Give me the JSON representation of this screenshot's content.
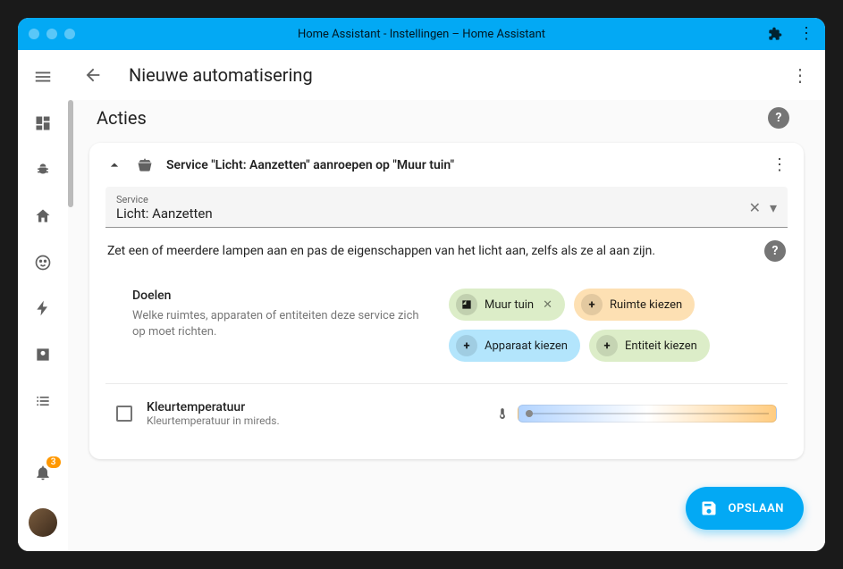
{
  "window_title": "Home Assistant - Instellingen – Home Assistant",
  "appbar": {
    "title": "Nieuwe automatisering"
  },
  "section": {
    "title": "Acties"
  },
  "action": {
    "header": "Service \"Licht: Aanzetten\" aanroepen op \"Muur tuin\"",
    "service_label": "Service",
    "service_value": "Licht: Aanzetten",
    "description": "Zet een of meerdere lampen aan en pas de eigenschappen van het licht aan, zelfs als ze al aan zijn."
  },
  "targets": {
    "title": "Doelen",
    "subtitle": "Welke ruimtes, apparaten of entiteiten deze service zich op moet richten.",
    "selected_area": "Muur tuin",
    "add_area": "Ruimte kiezen",
    "add_device": "Apparaat kiezen",
    "add_entity": "Entiteit kiezen"
  },
  "prop": {
    "title": "Kleurtemperatuur",
    "subtitle": "Kleurtemperatuur in mireds."
  },
  "rail": {
    "notification_count": "3"
  },
  "fab": {
    "label": "OPSLAAN"
  }
}
